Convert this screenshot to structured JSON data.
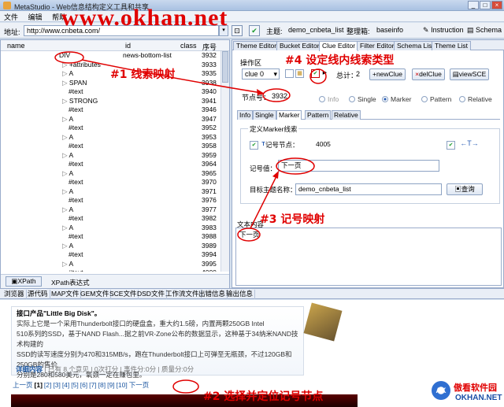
{
  "titlebar": {
    "title": "MetaStudio - Web信息结构定义工具和共享",
    "buttons": [
      "_",
      "□",
      "×"
    ]
  },
  "menu": {
    "items": [
      "文件",
      "编辑",
      "帮助"
    ]
  },
  "toolbar": {
    "address_label": "地址:",
    "url": "http://www.cnbeta.com/",
    "theme_label": "主题:",
    "theme_value": "demo_cnbeta_list",
    "organizer_label": "整理箱:",
    "organizer_value": "baseinfo",
    "instruction_label": "Instruction",
    "schema_label": "Schema"
  },
  "dom_tree": {
    "headers": {
      "name": "name",
      "id": "id",
      "class": "class",
      "seq": "序号"
    },
    "rows": [
      {
        "name": "DIV",
        "cls": "news-bottom-list",
        "seq": "3932",
        "indent": 0,
        "arrow": ""
      },
      {
        "name": "+attributes",
        "cls": "",
        "seq": "3933",
        "indent": 1,
        "arrow": "▷"
      },
      {
        "name": "A",
        "cls": "",
        "seq": "3935",
        "indent": 1,
        "arrow": "▷"
      },
      {
        "name": "SPAN",
        "cls": "",
        "seq": "3938",
        "indent": 1,
        "arrow": "▷"
      },
      {
        "name": "#text",
        "cls": "",
        "seq": "3940",
        "indent": 1,
        "arrow": ""
      },
      {
        "name": "STRONG",
        "cls": "",
        "seq": "3941",
        "indent": 1,
        "arrow": "▷"
      },
      {
        "name": "#text",
        "cls": "",
        "seq": "3946",
        "indent": 1,
        "arrow": ""
      },
      {
        "name": "A",
        "cls": "",
        "seq": "3947",
        "indent": 1,
        "arrow": "▷"
      },
      {
        "name": "#text",
        "cls": "",
        "seq": "3952",
        "indent": 1,
        "arrow": ""
      },
      {
        "name": "A",
        "cls": "",
        "seq": "3953",
        "indent": 1,
        "arrow": "▷"
      },
      {
        "name": "#text",
        "cls": "",
        "seq": "3958",
        "indent": 1,
        "arrow": ""
      },
      {
        "name": "A",
        "cls": "",
        "seq": "3959",
        "indent": 1,
        "arrow": "▷"
      },
      {
        "name": "#text",
        "cls": "",
        "seq": "3964",
        "indent": 1,
        "arrow": ""
      },
      {
        "name": "A",
        "cls": "",
        "seq": "3965",
        "indent": 1,
        "arrow": "▷"
      },
      {
        "name": "#text",
        "cls": "",
        "seq": "3970",
        "indent": 1,
        "arrow": ""
      },
      {
        "name": "A",
        "cls": "",
        "seq": "3971",
        "indent": 1,
        "arrow": "▷"
      },
      {
        "name": "#text",
        "cls": "",
        "seq": "3976",
        "indent": 1,
        "arrow": ""
      },
      {
        "name": "A",
        "cls": "",
        "seq": "3977",
        "indent": 1,
        "arrow": "▷"
      },
      {
        "name": "#text",
        "cls": "",
        "seq": "3982",
        "indent": 1,
        "arrow": ""
      },
      {
        "name": "A",
        "cls": "",
        "seq": "3983",
        "indent": 1,
        "arrow": "▷"
      },
      {
        "name": "#text",
        "cls": "",
        "seq": "3988",
        "indent": 1,
        "arrow": ""
      },
      {
        "name": "A",
        "cls": "",
        "seq": "3989",
        "indent": 1,
        "arrow": "▷"
      },
      {
        "name": "#text",
        "cls": "",
        "seq": "3994",
        "indent": 1,
        "arrow": ""
      },
      {
        "name": "A",
        "cls": "",
        "seq": "3995",
        "indent": 1,
        "arrow": "▷"
      },
      {
        "name": "#text",
        "cls": "",
        "seq": "4000",
        "indent": 1,
        "arrow": ""
      }
    ],
    "xpath_button": "XPath",
    "xpath_label": "XPath表达式"
  },
  "right_tabs": [
    "Theme Editor",
    "Bucket Editor",
    "Clue Editor",
    "Filter Editor",
    "Schema List",
    "Theme List"
  ],
  "clue_editor": {
    "op_zone": "操作区",
    "clue_select": "clue 0",
    "total_label": "总计：",
    "total_value": "2",
    "btn_new": "newClue",
    "btn_del": "delClue",
    "btn_view": "viewSCE",
    "node_label": "节点号：",
    "node_value": "3932",
    "radios": [
      {
        "label": "Info",
        "selected": false,
        "enabled": false
      },
      {
        "label": "Single",
        "selected": false,
        "enabled": true
      },
      {
        "label": "Marker",
        "selected": true,
        "enabled": true
      },
      {
        "label": "Pattern",
        "selected": false,
        "enabled": true
      },
      {
        "label": "Relative",
        "selected": false,
        "enabled": true
      }
    ],
    "sub_tabs": [
      "Info",
      "Single",
      "Marker",
      "Pattern",
      "Relative"
    ],
    "marker_group_title": "定义Marker线索",
    "record_node_label": "记号节点：",
    "record_node_value": "4005",
    "record_value_label": "记号值：",
    "record_value": "下一页",
    "target_label": "目标主题名称：",
    "target_value": "demo_cnbeta_list",
    "query_button": "查询",
    "text_label": "文本内容",
    "text_content": "下一页"
  },
  "bottom_tabs": [
    "浏览器",
    "源代码",
    "MAP文件",
    "GEM文件",
    "SCE文件",
    "DSD文件",
    "工作流文件",
    "出错信息",
    "输出信息"
  ],
  "browser": {
    "ad_title": "接口产品\"Little Big Disk\"。",
    "ad_lines": [
      "实际上它是一个采用Thunderbolt接口的硬盘盒，重大约1.5磅，内置两颗250GB Intel",
      "510系列的SSD，基于NAND Flash...据之前VR-Zone公布的数据显示，这种基于34纳米NAND技术构建的",
      "SSD的读写速度分别为470和315MB/s，跑在Thunderbolt接口上可弹至无瓶颈，不过120GB和250GB的售价",
      "分别是280和580美元，氧颈一定在赚包里。"
    ],
    "meta_read_more": "详细内容",
    "meta_rest": "| 已有 8 个意见 | 0次打分 | 事件分:0分 | 质量分:0分",
    "pager": [
      "上一页",
      "[1]",
      "[2]",
      "[3]",
      "[4]",
      "[5]",
      "[6]",
      "[7]",
      "[8]",
      "[9]",
      "[10]",
      "下一页"
    ]
  },
  "annotations": {
    "a1": "#1 线索映射",
    "a2": "#2 选择并定位记号节点",
    "a3": "#3 记号映射",
    "a4": "#4 设定线内线索类型",
    "watermark": "www.okhan.net",
    "logo_line1": "傲看软件园",
    "logo_line2": "OKHAN.NET",
    "logo_mark": "AK"
  },
  "colors": {
    "annotation": "#e00000",
    "accent": "#2b5fb6"
  }
}
